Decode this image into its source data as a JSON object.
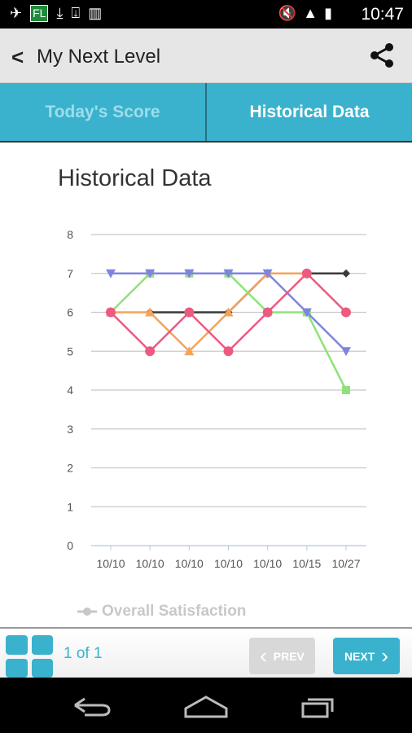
{
  "status_bar": {
    "time": "10:47",
    "notification_badge": "FL"
  },
  "app_bar": {
    "title": "My Next Level",
    "back_icon": "chevron-left-icon",
    "share_icon": "share-icon"
  },
  "tabs": [
    {
      "label": "Today's Score",
      "selected": false
    },
    {
      "label": "Historical Data",
      "selected": true
    }
  ],
  "section_title": "Historical Data",
  "chart_data": {
    "type": "line",
    "categories": [
      "10/10",
      "10/10",
      "10/10",
      "10/10",
      "10/10",
      "10/15",
      "10/27"
    ],
    "ylim": [
      0,
      8
    ],
    "yticks": [
      0,
      1,
      2,
      3,
      4,
      5,
      6,
      7,
      8
    ],
    "grid": true,
    "series": [
      {
        "color": "#3a3a3a",
        "marker": "diamond",
        "values": [
          null,
          6,
          6,
          6,
          7,
          7,
          7
        ]
      },
      {
        "color": "#f5a35a",
        "marker": "triangle-up",
        "values": [
          6,
          6,
          5,
          6,
          7,
          7,
          null
        ]
      },
      {
        "color": "#8fe27a",
        "marker": "square",
        "values": [
          6,
          7,
          7,
          7,
          6,
          6,
          4
        ]
      },
      {
        "color": "#7f84e0",
        "marker": "triangle-down",
        "values": [
          7,
          7,
          7,
          7,
          7,
          6,
          5
        ]
      },
      {
        "color": "#ec5a80",
        "marker": "circle",
        "values": [
          6,
          5,
          6,
          5,
          6,
          7,
          6
        ]
      }
    ],
    "legend": [
      {
        "label": "Overall Satisfaction"
      }
    ]
  },
  "footer": {
    "page_indicator": "1 of 1",
    "prev_label": "PREV",
    "next_label": "NEXT",
    "prev_enabled": false
  }
}
